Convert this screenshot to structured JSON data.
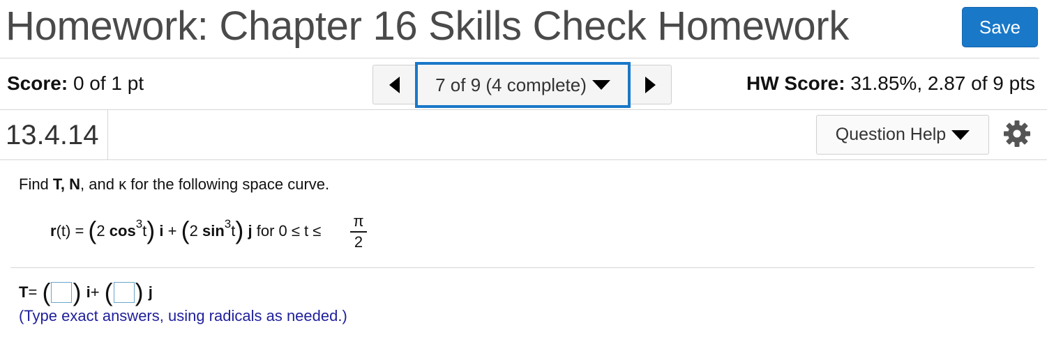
{
  "header": {
    "title": "Homework: Chapter 16 Skills Check Homework",
    "save_label": "Save"
  },
  "score": {
    "label": "Score:",
    "value": "0 of 1 pt",
    "hw_label": "HW Score:",
    "hw_value": "31.85%, 2.87 of 9 pts"
  },
  "nav": {
    "current": "7 of 9 (4 complete)",
    "prev_icon": "triangle-left-icon",
    "next_icon": "triangle-right-icon"
  },
  "question": {
    "number": "13.4.14",
    "help_label": "Question Help",
    "settings_icon": "gear-icon"
  },
  "content": {
    "prompt_pre": "Find ",
    "prompt_T": "T,",
    "prompt_N": " N",
    "prompt_mid": ", and ",
    "prompt_kappa": "κ",
    "prompt_post": " for the following space curve.",
    "eq_r": "r",
    "eq_t_eq": "(t) = ",
    "eq_coef1": "2 ",
    "eq_cos": "cos",
    "eq_exp1": "3",
    "eq_t1": "t",
    "eq_i": "i",
    "eq_plus": " + ",
    "eq_coef2": "2 ",
    "eq_sin": "sin",
    "eq_exp2": "3",
    "eq_t2": "t",
    "eq_j": "j",
    "eq_for": " for 0 ≤ t ≤ ",
    "eq_frac_num": "π",
    "eq_frac_den": "2",
    "answer_T": "T",
    "answer_eq": " = ",
    "answer_i": "i",
    "answer_plus": " + ",
    "answer_j": "j",
    "hint": "(Type exact answers, using radicals as needed.)"
  },
  "colors": {
    "accent": "#1a78c8",
    "hint_text": "#1f1f9c"
  }
}
